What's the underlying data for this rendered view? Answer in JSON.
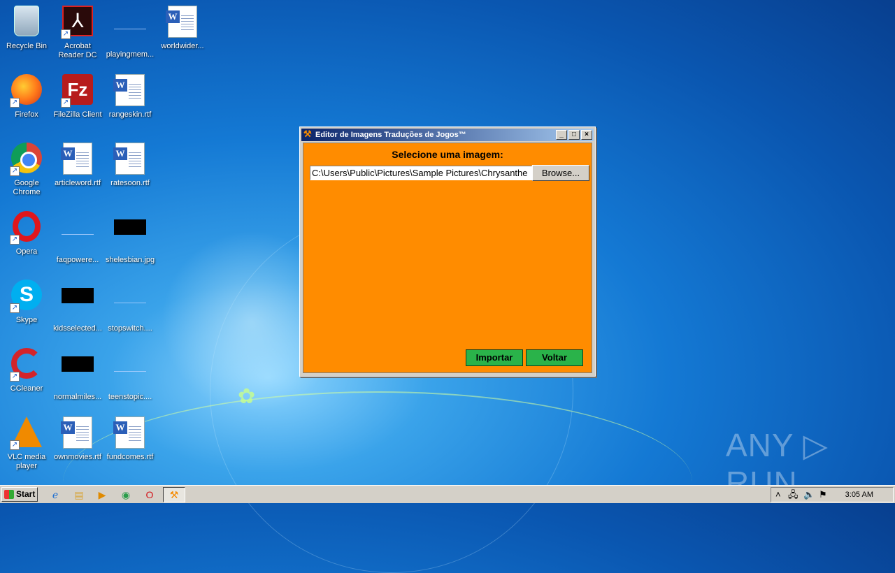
{
  "desktop": {
    "icons": [
      {
        "label": "Recycle Bin",
        "icon": "recycle-bin-icon"
      },
      {
        "label": "Acrobat Reader DC",
        "icon": "acrobat-icon"
      },
      {
        "label": "playingmem...",
        "icon": "file-thumbnail-icon"
      },
      {
        "label": "worldwider...",
        "icon": "word-document-icon"
      },
      {
        "label": "Firefox",
        "icon": "firefox-icon"
      },
      {
        "label": "FileZilla Client",
        "icon": "filezilla-icon"
      },
      {
        "label": "rangeskin.rtf",
        "icon": "word-document-icon"
      },
      {
        "label": "Google Chrome",
        "icon": "chrome-icon"
      },
      {
        "label": "articleword.rtf",
        "icon": "word-document-icon"
      },
      {
        "label": "ratesoon.rtf",
        "icon": "word-document-icon"
      },
      {
        "label": "Opera",
        "icon": "opera-icon"
      },
      {
        "label": "faqpowere...",
        "icon": "file-thumbnail-icon"
      },
      {
        "label": "shelesbian.jpg",
        "icon": "image-thumbnail-icon"
      },
      {
        "label": "Skype",
        "icon": "skype-icon"
      },
      {
        "label": "kidsselected...",
        "icon": "image-thumbnail-icon"
      },
      {
        "label": "stopswitch....",
        "icon": "file-thumbnail-icon"
      },
      {
        "label": "CCleaner",
        "icon": "ccleaner-icon"
      },
      {
        "label": "normalmiles...",
        "icon": "image-thumbnail-icon"
      },
      {
        "label": "teenstopic....",
        "icon": "file-thumbnail-icon"
      },
      {
        "label": "VLC media player",
        "icon": "vlc-icon"
      },
      {
        "label": "ownmovies.rtf",
        "icon": "word-document-icon"
      },
      {
        "label": "fundcomes.rtf",
        "icon": "word-document-icon"
      }
    ],
    "watermark": "ANY ▷ RUN"
  },
  "window": {
    "title": "Editor de Imagens Traduções de Jogos™",
    "prompt": "Selecione uma imagem:",
    "path_value": "C:\\Users\\Public\\Pictures\\Sample Pictures\\Chrysanthe",
    "browse_label": "Browse...",
    "import_label": "Importar",
    "back_label": "Voltar",
    "minimize_glyph": "_",
    "maximize_glyph": "□",
    "close_glyph": "×",
    "client_color": "#ff8c00",
    "button_color": "#2ab34a"
  },
  "taskbar": {
    "start_label": "Start",
    "clock": "3:05 AM"
  }
}
